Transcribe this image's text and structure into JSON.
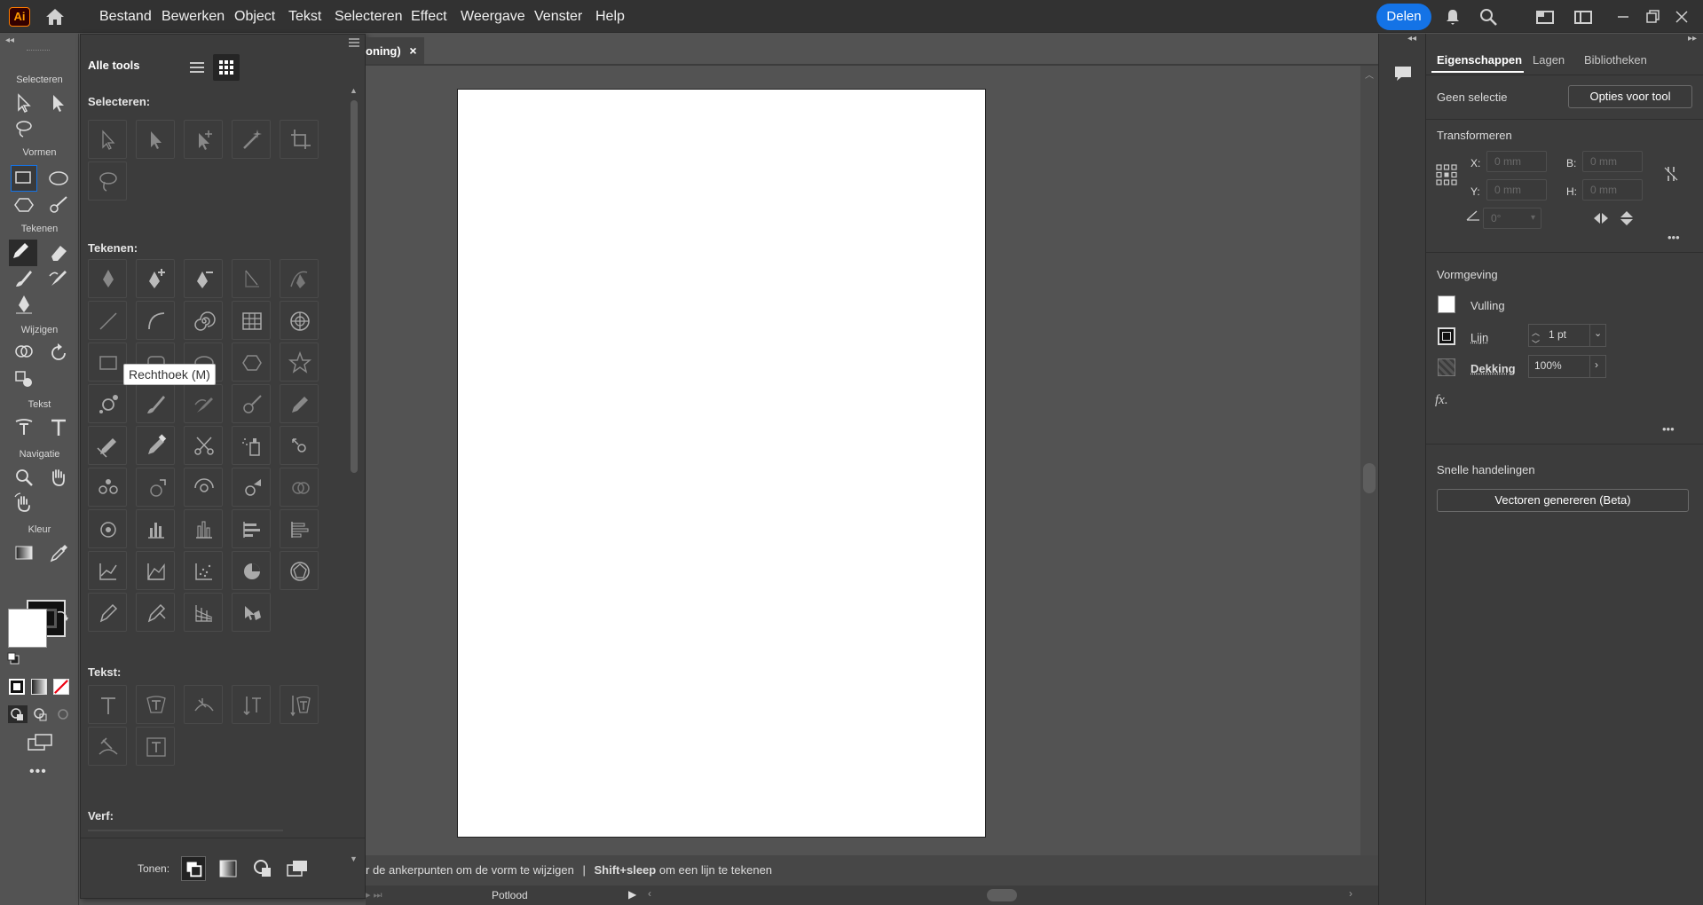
{
  "app": {
    "logo": "Ai"
  },
  "menu": [
    "Bestand",
    "Bewerken",
    "Object",
    "Tekst",
    "Selecteren",
    "Effect",
    "Weergave",
    "Venster",
    "Help"
  ],
  "share_label": "Delen",
  "tools_strip": {
    "groups": [
      "Selecteren",
      "Vormen",
      "Tekenen",
      "Wijzigen",
      "Tekst",
      "Navigatie",
      "Kleur"
    ],
    "more": "•••"
  },
  "all_tools": {
    "title": "Alle tools",
    "sections": {
      "selecteren": "Selecteren:",
      "tekenen": "Tekenen:",
      "tekst": "Tekst:",
      "verf": "Verf:"
    },
    "tonen_label": "Tonen:",
    "tooltip": "Rechthoek (M)"
  },
  "document": {
    "tab_title": "oning)",
    "close": "×"
  },
  "status": {
    "hint_part1": "r de ankerpunten om de vorm te wijzigen",
    "separator": "|",
    "hint_bold": "Shift+sleep",
    "hint_part2": "om een lijn te tekenen",
    "tool_name": "Potlood"
  },
  "properties": {
    "tabs": [
      "Eigenschappen",
      "Lagen",
      "Bibliotheken"
    ],
    "no_selection": "Geen selectie",
    "tool_options_btn": "Opties voor tool",
    "transform_title": "Transformeren",
    "x_label": "X:",
    "y_label": "Y:",
    "w_label": "B:",
    "h_label": "H:",
    "x_value": "0 mm",
    "y_value": "0 mm",
    "w_value": "0 mm",
    "h_value": "0 mm",
    "angle_value": "0°",
    "appearance_title": "Vormgeving",
    "fill_label": "Vulling",
    "stroke_label": "Lijn",
    "stroke_value": "1 pt",
    "opacity_label": "Dekking",
    "opacity_value": "100%",
    "fx_label": "fx.",
    "more": "•••",
    "quick_actions_title": "Snelle handelingen",
    "generate_vectors_btn": "Vectoren genereren (Beta)"
  },
  "colors": {
    "accent": "#1473e6",
    "panel": "#3c3c3c",
    "canvas": "#535353",
    "menubar": "#323232"
  }
}
